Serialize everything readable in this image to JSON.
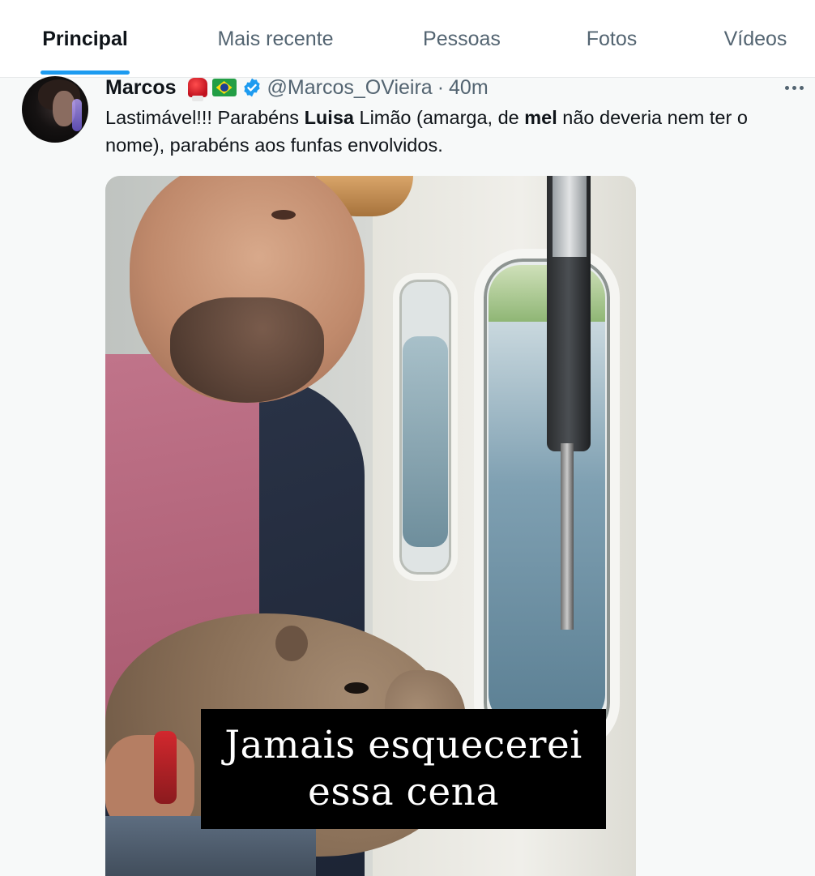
{
  "tabs": [
    {
      "label": "Principal",
      "active": true
    },
    {
      "label": "Mais recente",
      "active": false
    },
    {
      "label": "Pessoas",
      "active": false
    },
    {
      "label": "Fotos",
      "active": false
    },
    {
      "label": "Vídeos",
      "active": false
    }
  ],
  "accent_color": "#1d9bf0",
  "tweet": {
    "author": {
      "name": "Marcos",
      "badges": [
        "boxing-glove-emoji",
        "brazil-flag-emoji",
        "verified-badge"
      ],
      "handle": "@Marcos_OVieira",
      "separator": "·",
      "time": "40m"
    },
    "text": {
      "p1": "Lastimável!!! Parabéns ",
      "b1": "Luisa",
      "p2": " Limão (amarga, de ",
      "b2": "mel",
      "p3": " não deveria nem ter o nome), parabéns aos funfas envolvidos."
    },
    "media": {
      "caption_line1": "Jamais esquecerei",
      "caption_line2": "essa cena"
    }
  }
}
